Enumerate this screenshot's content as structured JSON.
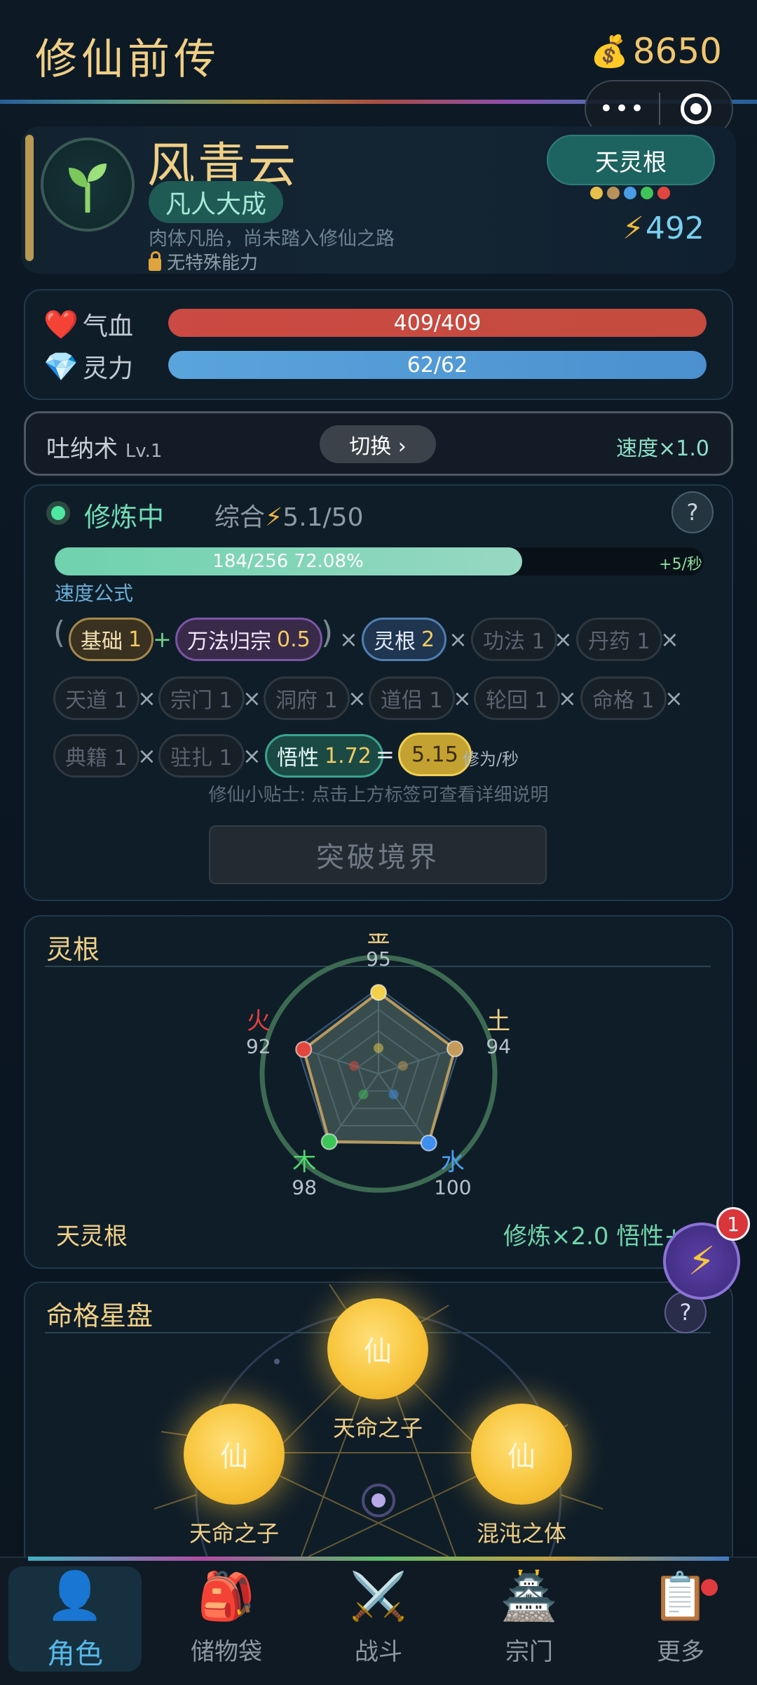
{
  "header": {
    "title": "修仙前传",
    "coins": "8650",
    "coin_icon": "money-bag-icon"
  },
  "capsule": {
    "more": "•••",
    "target_icon": "target-icon"
  },
  "profile": {
    "name": "风青云",
    "realm": "凡人大成",
    "description": "肉体凡胎，尚未踏入修仙之路",
    "ability": "无特殊能力",
    "root_badge": "天灵根",
    "root_dot_colors": [
      "#e8c04a",
      "#b8925a",
      "#4a9de6",
      "#3fc45a",
      "#e2473f"
    ],
    "power": "492"
  },
  "stats": {
    "hp": {
      "label": "气血",
      "value": "409/409",
      "fraction": 1.0
    },
    "mp": {
      "label": "灵力",
      "value": "62/62",
      "fraction": 1.0
    }
  },
  "technique": {
    "name": "吐纳术",
    "level": "Lv.1",
    "switch_label": "切换 ›",
    "speed": "速度×1.0"
  },
  "cultivation": {
    "status": "修炼中",
    "total_label": "综合",
    "total_value": "5.1/50",
    "progress_text": "184/256  72.08%",
    "progress_fraction": 0.7208,
    "rate": "+5/秒",
    "formula_label": "速度公式",
    "chips": {
      "base": {
        "label": "基础",
        "value": "1"
      },
      "method": {
        "label": "万法归宗",
        "value": "0.5"
      },
      "root": {
        "label": "灵根",
        "value": "2"
      },
      "gongfa": "功法 1",
      "danyao": "丹药 1",
      "tiandao": "天道 1",
      "zongmen": "宗门 1",
      "dongfu": "洞府 1",
      "daolv": "道侣 1",
      "lunhui": "轮回 1",
      "mingge": "命格 1",
      "dianji": "典籍 1",
      "zhuzha": "驻扎 1",
      "wuxing": {
        "label": "悟性",
        "value": "1.72"
      },
      "result": "5.15"
    },
    "unit": "修为/秒",
    "tip": "修仙小贴士: 点击上方标签可查看详细说明",
    "break_label": "突破境界"
  },
  "spirit_root": {
    "title": "灵根",
    "elements": [
      {
        "name": "金",
        "value": 95,
        "color": "#f2d04a",
        "label_color": "#f0cf85"
      },
      {
        "name": "土",
        "value": 94,
        "color": "#c59a5a",
        "label_color": "#f0cf85"
      },
      {
        "name": "水",
        "value": 100,
        "color": "#3f8ff0",
        "label_color": "#4aa0f0"
      },
      {
        "name": "木",
        "value": 98,
        "color": "#3fc45a",
        "label_color": "#4fd86a"
      },
      {
        "name": "火",
        "value": 92,
        "color": "#e2473f",
        "label_color": "#e04040"
      }
    ],
    "footer_name": "天灵根",
    "footer_bonus": "修炼×2.0  悟性+10"
  },
  "fate": {
    "title": "命格星盘",
    "orb_glyph": "仙",
    "orbs": [
      "天命之子",
      "天命之子",
      "混沌之体"
    ]
  },
  "fab": {
    "badge": "1"
  },
  "nav": [
    {
      "label": "角色",
      "icon": "👤"
    },
    {
      "label": "储物袋",
      "icon": "🎒"
    },
    {
      "label": "战斗",
      "icon": "⚔️"
    },
    {
      "label": "宗门",
      "icon": "🏯"
    },
    {
      "label": "更多",
      "icon": "📋"
    }
  ]
}
